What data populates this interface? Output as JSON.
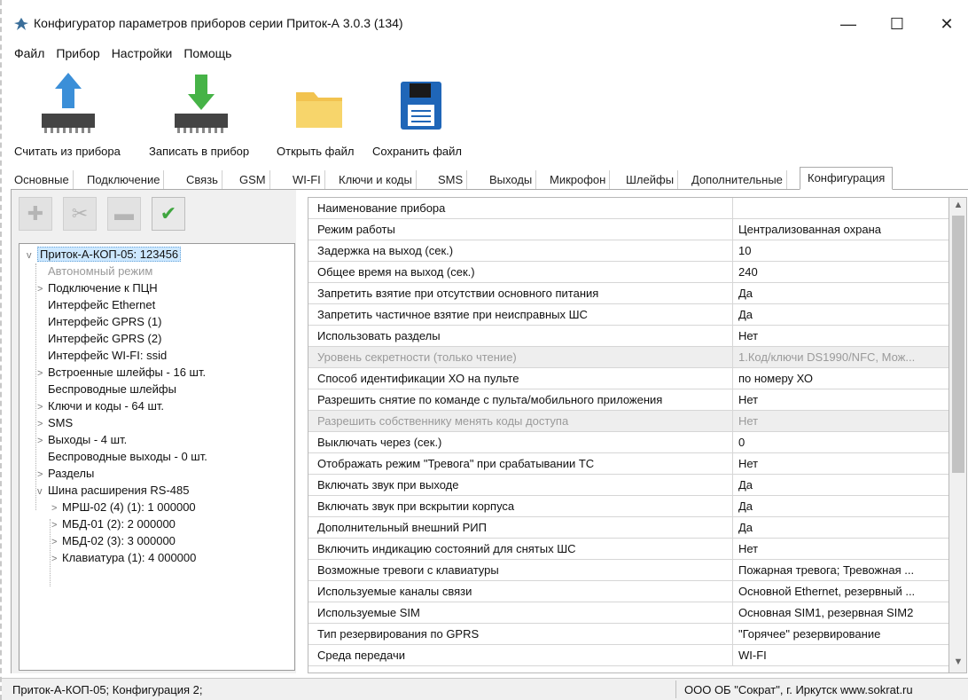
{
  "window": {
    "title": "Конфигуратор параметров приборов серии Приток-А  3.0.3 (134)",
    "min_symbol": "—",
    "max_symbol": "☐",
    "close_symbol": "✕"
  },
  "menu": [
    "Файл",
    "Прибор",
    "Настройки",
    "Помощь"
  ],
  "toolbar": {
    "read_label": "Считать из прибора",
    "write_label": "Записать в прибор",
    "open_label": "Открыть файл",
    "save_label": "Сохранить файл"
  },
  "tabs": [
    "Основные",
    "Подключение",
    "Связь",
    "GSM",
    "WI-FI",
    "Ключи и коды",
    "SMS",
    "Выходы",
    "Микрофон",
    "Шлейфы",
    "Дополнительные",
    "Конфигурация"
  ],
  "active_tab": "Конфигурация",
  "left_toolbar": {
    "add_symbol": "✚",
    "cut_symbol": "✂",
    "remove_symbol": "▬",
    "apply_symbol": "✔"
  },
  "tree": [
    {
      "label": "Приток-А-КОП-05: 123456",
      "level": 0,
      "arrow": "v",
      "selected": true
    },
    {
      "label": "Автономный режим",
      "level": 1,
      "arrow": "",
      "dim": true
    },
    {
      "label": "Подключение к ПЦН",
      "level": 1,
      "arrow": ">"
    },
    {
      "label": "Интерфейс Ethernet",
      "level": 1,
      "arrow": ""
    },
    {
      "label": "Интерфейс GPRS (1)",
      "level": 1,
      "arrow": ""
    },
    {
      "label": "Интерфейс GPRS (2)",
      "level": 1,
      "arrow": ""
    },
    {
      "label": "Интерфейс WI-FI: ssid",
      "level": 1,
      "arrow": ""
    },
    {
      "label": "Встроенные шлейфы - 16 шт.",
      "level": 1,
      "arrow": ">"
    },
    {
      "label": "Беспроводные шлейфы",
      "level": 1,
      "arrow": ""
    },
    {
      "label": "Ключи и коды - 64 шт.",
      "level": 1,
      "arrow": ">"
    },
    {
      "label": "SMS",
      "level": 1,
      "arrow": ">"
    },
    {
      "label": "Выходы - 4 шт.",
      "level": 1,
      "arrow": ">"
    },
    {
      "label": "Беспроводные выходы - 0 шт.",
      "level": 1,
      "arrow": ""
    },
    {
      "label": "Разделы",
      "level": 1,
      "arrow": ">"
    },
    {
      "label": "Шина расширения RS-485",
      "level": 1,
      "arrow": "v"
    },
    {
      "label": "МРШ-02 (4) (1): 1 000000",
      "level": 2,
      "arrow": ">"
    },
    {
      "label": "МБД-01 (2): 2 000000",
      "level": 2,
      "arrow": ">"
    },
    {
      "label": "МБД-02 (3): 3 000000",
      "level": 2,
      "arrow": ">"
    },
    {
      "label": "Клавиатура (1): 4 000000",
      "level": 2,
      "arrow": ">"
    }
  ],
  "properties": [
    {
      "name": "Наименование прибора",
      "value": ""
    },
    {
      "name": "Режим работы",
      "value": "Централизованная охрана"
    },
    {
      "name": "Задержка на выход (сек.)",
      "value": "10"
    },
    {
      "name": "Общее время на выход (сек.)",
      "value": "240"
    },
    {
      "name": "Запретить взятие при отсутствии основного питания",
      "value": "Да"
    },
    {
      "name": "Запретить частичное взятие при неисправных ШС",
      "value": "Да"
    },
    {
      "name": "Использовать разделы",
      "value": "Нет"
    },
    {
      "name": "Уровень секретности (только чтение)",
      "value": "1.Код/ключи DS1990/NFC, Мож...",
      "readonly": true
    },
    {
      "name": "Способ идентификации ХО на пульте",
      "value": "по номеру ХО"
    },
    {
      "name": "Разрешить снятие по команде с пульта/мобильного приложения",
      "value": "Нет"
    },
    {
      "name": "Разрешить собственнику менять коды доступа",
      "value": "Нет",
      "readonly": true
    },
    {
      "name": "Выключать через (сек.)",
      "value": "0"
    },
    {
      "name": "Отображать режим \"Тревога\" при срабатывании ТС",
      "value": "Нет"
    },
    {
      "name": "Включать звук при выходе",
      "value": "Да"
    },
    {
      "name": "Включать звук при вскрытии корпуса",
      "value": "Да"
    },
    {
      "name": "Дополнительный внешний РИП",
      "value": "Да"
    },
    {
      "name": "Включить индикацию состояний для снятых ШС",
      "value": "Нет"
    },
    {
      "name": "Возможные тревоги с клавиатуры",
      "value": "Пожарная тревога; Тревожная ..."
    },
    {
      "name": "Используемые каналы связи",
      "value": "Основной Ethernet, резервный ..."
    },
    {
      "name": "Используемые SIM",
      "value": "Основная SIM1, резервная SIM2"
    },
    {
      "name": "Тип резервирования по GPRS",
      "value": "\"Горячее\" резервирование"
    },
    {
      "name": "Среда передачи",
      "value": "WI-FI"
    }
  ],
  "status": {
    "left": "Приток-А-КОП-05; Конфигурация 2;",
    "right": "ООО ОБ \"Сократ\", г. Иркутск   www.sokrat.ru"
  },
  "colors": {
    "selection": "#cde8ff",
    "readonly_row": "#eeeeee",
    "apply_green": "#3fa63f"
  }
}
